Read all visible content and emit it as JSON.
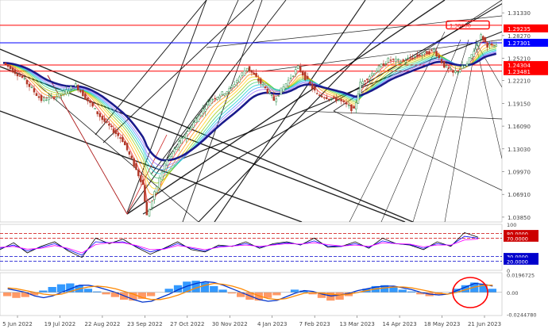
{
  "chart_data": [
    {
      "type": "candlestick",
      "panel": "price",
      "price_axis": {
        "ticks": [
          "1.31330",
          "1.29235",
          "1.28270",
          "1.27301",
          "1.25210",
          "1.24304",
          "1.23481",
          "1.22210",
          "1.19150",
          "1.16090",
          "1.13030",
          "1.09970",
          "1.06910",
          "1.03850"
        ],
        "ylim": [
          1.032,
          1.322
        ],
        "highlighted_levels": [
          {
            "label": "1.29235",
            "value": 1.2965,
            "color": "#ff0000"
          },
          {
            "label": "1.27301",
            "value": 1.27301,
            "color": "#0000ff"
          },
          {
            "label": "1.24304",
            "value": 1.24304,
            "color": "#ff0000"
          },
          {
            "label": "1.23481",
            "value": 1.23481,
            "color": "#ff0000"
          }
        ],
        "label_box": {
          "label": "1.30000",
          "value": 1.297,
          "color": "#ff0000"
        }
      },
      "x_axis_labels": [
        "5 Jun 2022",
        "19 Jul 2022",
        "22 Aug 2022",
        "23 Sep 2022",
        "27 Oct 2022",
        "30 Nov 2022",
        "4 Jan 2023",
        "7 Feb 2023",
        "13 Mar 2023",
        "14 Apr 2023",
        "18 May 2023",
        "21 Jun 2023"
      ],
      "price_series": [
        {
          "date": "2022-06-05",
          "close": 1.246
        },
        {
          "date": "2022-06-20",
          "close": 1.226
        },
        {
          "date": "2022-07-05",
          "close": 1.196
        },
        {
          "date": "2022-07-19",
          "close": 1.202
        },
        {
          "date": "2022-08-01",
          "close": 1.216
        },
        {
          "date": "2022-08-22",
          "close": 1.17
        },
        {
          "date": "2022-09-07",
          "close": 1.142
        },
        {
          "date": "2022-09-23",
          "close": 1.082
        },
        {
          "date": "2022-09-26",
          "close": 1.04
        },
        {
          "date": "2022-10-10",
          "close": 1.11
        },
        {
          "date": "2022-10-27",
          "close": 1.152
        },
        {
          "date": "2022-11-15",
          "close": 1.196
        },
        {
          "date": "2022-11-30",
          "close": 1.21
        },
        {
          "date": "2022-12-14",
          "close": 1.24
        },
        {
          "date": "2022-12-30",
          "close": 1.208
        },
        {
          "date": "2023-01-04",
          "close": 1.196
        },
        {
          "date": "2023-01-23",
          "close": 1.24
        },
        {
          "date": "2023-02-07",
          "close": 1.203
        },
        {
          "date": "2023-02-24",
          "close": 1.196
        },
        {
          "date": "2023-03-08",
          "close": 1.182
        },
        {
          "date": "2023-03-13",
          "close": 1.218
        },
        {
          "date": "2023-04-04",
          "close": 1.25
        },
        {
          "date": "2023-04-14",
          "close": 1.248
        },
        {
          "date": "2023-05-10",
          "close": 1.263
        },
        {
          "date": "2023-05-18",
          "close": 1.242
        },
        {
          "date": "2023-05-25",
          "close": 1.232
        },
        {
          "date": "2023-06-05",
          "close": 1.244
        },
        {
          "date": "2023-06-16",
          "close": 1.282
        },
        {
          "date": "2023-06-21",
          "close": 1.27
        },
        {
          "date": "2023-06-28",
          "close": 1.268
        }
      ]
    },
    {
      "type": "line",
      "panel": "oscillator",
      "axis_ticks": [
        "100",
        "80.0000",
        "70.0000",
        "30.0000",
        "20.0000",
        "0"
      ],
      "ylim": [
        0,
        100
      ],
      "reference_levels": [
        80,
        70,
        30,
        20
      ],
      "series": [
        {
          "color": "#000000",
          "values": [
            45,
            60,
            38,
            52,
            62,
            42,
            28,
            70,
            58,
            68,
            50,
            35,
            48,
            62,
            45,
            40,
            55,
            52,
            62,
            48,
            58,
            62,
            55,
            70,
            50,
            52,
            62,
            48,
            70,
            58,
            55,
            45,
            62,
            52,
            82,
            72
          ]
        },
        {
          "color": "#0000ff",
          "values": [
            48,
            55,
            42,
            50,
            58,
            45,
            33,
            62,
            60,
            62,
            52,
            40,
            47,
            58,
            48,
            42,
            52,
            53,
            58,
            50,
            56,
            60,
            56,
            64,
            53,
            52,
            58,
            50,
            64,
            58,
            56,
            48,
            58,
            54,
            74,
            70
          ]
        },
        {
          "color": "#ff00ff",
          "values": [
            50,
            52,
            46,
            48,
            54,
            48,
            38,
            56,
            60,
            60,
            54,
            45,
            46,
            54,
            50,
            45,
            50,
            53,
            55,
            52,
            55,
            58,
            57,
            60,
            56,
            53,
            55,
            52,
            60,
            58,
            57,
            51,
            55,
            55,
            66,
            68
          ]
        }
      ]
    },
    {
      "type": "bar",
      "panel": "macd",
      "axis_ticks": [
        "0.0196725",
        "0.00",
        "-0.0244780"
      ],
      "ylim": [
        -0.026,
        0.022
      ],
      "histogram": [
        -0.004,
        -0.006,
        -0.005,
        -0.003,
        0.002,
        0.006,
        0.009,
        0.01,
        0.008,
        0.004,
        0.001,
        -0.002,
        -0.005,
        -0.008,
        -0.009,
        -0.007,
        -0.004,
        0.0,
        0.004,
        0.008,
        0.012,
        0.013,
        0.011,
        0.007,
        0.003,
        -0.001,
        -0.005,
        -0.008,
        -0.009,
        -0.006,
        -0.003,
        0.0,
        0.003,
        0.002,
        -0.002,
        -0.006,
        -0.009,
        -0.008,
        -0.004,
        0.0,
        0.004,
        0.007,
        0.008,
        0.006,
        0.003,
        0.001,
        -0.002,
        -0.004,
        -0.003,
        0.0,
        0.004,
        0.008,
        0.011,
        0.009,
        0.004
      ],
      "macd_line": [
        0.004,
        0.002,
        0.0,
        -0.004,
        -0.006,
        -0.004,
        0.0,
        0.004,
        0.008,
        0.008,
        0.006,
        0.003,
        0.0,
        -0.004,
        -0.008,
        -0.011,
        -0.01,
        -0.006,
        -0.002,
        0.003,
        0.007,
        0.01,
        0.012,
        0.011,
        0.008,
        0.004,
        0.0,
        -0.004,
        -0.008,
        -0.01,
        -0.009,
        -0.005,
        -0.001,
        0.002,
        0.001,
        -0.002,
        -0.004,
        -0.003,
        -0.001,
        0.002,
        0.004,
        0.006,
        0.007,
        0.007,
        0.005,
        0.003,
        0.0,
        -0.002,
        -0.003,
        -0.002,
        0.002,
        0.006,
        0.01,
        0.009,
        0.007
      ],
      "signal_line": [
        0.005,
        0.004,
        0.002,
        0.0,
        -0.002,
        -0.003,
        -0.002,
        0.001,
        0.004,
        0.006,
        0.007,
        0.006,
        0.004,
        0.001,
        -0.002,
        -0.006,
        -0.008,
        -0.008,
        -0.006,
        -0.003,
        0.001,
        0.005,
        0.008,
        0.01,
        0.009,
        0.007,
        0.004,
        0.0,
        -0.004,
        -0.007,
        -0.008,
        -0.007,
        -0.004,
        -0.001,
        0.0,
        -0.001,
        -0.002,
        -0.003,
        -0.002,
        0.0,
        0.002,
        0.004,
        0.005,
        0.006,
        0.006,
        0.005,
        0.003,
        0.001,
        -0.001,
        -0.002,
        0.0,
        0.003,
        0.006,
        0.008,
        0.008
      ]
    }
  ],
  "colors": {
    "resistance": "#ff0000",
    "price_level": "#0000ff",
    "trend_lines": "#000000",
    "ma_blue": "#1a1a8c",
    "histogram_pos": "#3399ff",
    "histogram_neg": "#ff9966",
    "macd_line": "#0033cc",
    "signal_line": "#ff8800"
  }
}
